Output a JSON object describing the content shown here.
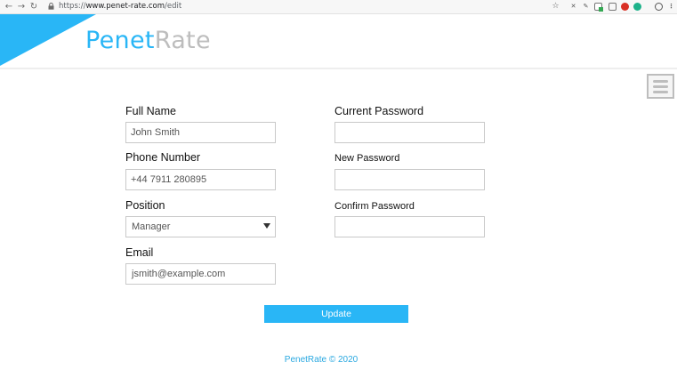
{
  "browser": {
    "url_prefix": "https://",
    "url_host": "www.penet-rate.com",
    "url_path": "/edit"
  },
  "brand": {
    "part1": "Penet",
    "part2": "Rate",
    "accent_color": "#29b6f6"
  },
  "form": {
    "full_name_label": "Full Name",
    "full_name_value": "John Smith",
    "phone_label": "Phone Number",
    "phone_value": "+44 7911 280895",
    "position_label": "Position",
    "position_value": "Manager",
    "email_label": "Email",
    "email_value": "jsmith@example.com",
    "current_password_label": "Current Password",
    "new_password_label": "New Password",
    "confirm_password_label": "Confirm Password",
    "update_label": "Update"
  },
  "footer": {
    "text": "PenetRate © 2020"
  },
  "icons": {
    "back": "back-arrow-icon",
    "forward": "forward-arrow-icon",
    "reload": "reload-icon",
    "lock": "lock-icon",
    "menu": "hamburger-menu-icon"
  }
}
